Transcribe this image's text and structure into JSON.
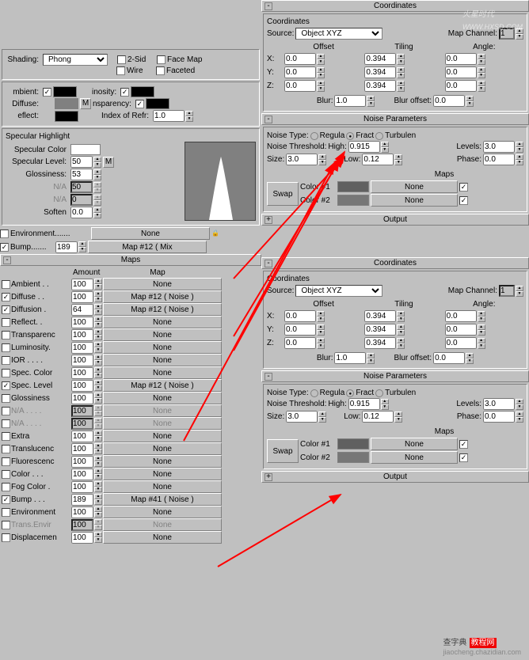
{
  "shading": {
    "label": "Shading:",
    "value": "Phong",
    "opts": {
      "twoSid": "2-Sid",
      "wire": "Wire",
      "faceMap": "Face Map",
      "faceted": "Faceted"
    }
  },
  "basic": {
    "ambient": "mbient:",
    "diffuse": "Diffuse:",
    "reflect": "eflect:",
    "luminosity": "inosity:",
    "transparency": "nsparency:",
    "ior": "Index of Refr:",
    "iorVal": "1.0"
  },
  "spec": {
    "title": "Specular Highlight",
    "color": "Specular Color",
    "level": "Specular Level:",
    "levelVal": "50",
    "gloss": "Glossiness:",
    "glossVal": "53",
    "na": "N/A",
    "naVal": "50",
    "na2": "0",
    "soften": "Soften",
    "softenVal": "0.0"
  },
  "env": {
    "env": "Environment.......",
    "none": "None",
    "bump": "Bump.......",
    "bumpVal": "189",
    "bumpMap": "Map #12  ( Mix"
  },
  "mapsHeader": "Maps",
  "mapsCol": {
    "amount": "Amount",
    "map": "Map"
  },
  "maps": [
    {
      "c": false,
      "n": "Ambient . .",
      "v": "100",
      "m": "None",
      "d": false
    },
    {
      "c": true,
      "n": "Diffuse . .",
      "v": "100",
      "m": "Map #12   ( Noise )",
      "d": false
    },
    {
      "c": true,
      "n": "Diffusion .",
      "v": "64",
      "m": "Map #12   ( Noise )",
      "d": false
    },
    {
      "c": false,
      "n": "Reflect. .",
      "v": "100",
      "m": "None",
      "d": false
    },
    {
      "c": false,
      "n": "Transparenc",
      "v": "100",
      "m": "None",
      "d": false
    },
    {
      "c": false,
      "n": "Luminosity.",
      "v": "100",
      "m": "None",
      "d": false
    },
    {
      "c": false,
      "n": "IOR . . . .",
      "v": "100",
      "m": "None",
      "d": false
    },
    {
      "c": false,
      "n": "Spec. Color",
      "v": "100",
      "m": "None",
      "d": false
    },
    {
      "c": true,
      "n": "Spec. Level",
      "v": "100",
      "m": "Map #12   ( Noise )",
      "d": false
    },
    {
      "c": false,
      "n": "Glossiness",
      "v": "100",
      "m": "None",
      "d": false
    },
    {
      "c": false,
      "n": "N/A . . . .",
      "v": "100",
      "m": "None",
      "d": true
    },
    {
      "c": false,
      "n": "N/A . . . .",
      "v": "100",
      "m": "None",
      "d": true
    },
    {
      "c": false,
      "n": "Extra",
      "v": "100",
      "m": "None",
      "d": false
    },
    {
      "c": false,
      "n": "Translucenc",
      "v": "100",
      "m": "None",
      "d": false
    },
    {
      "c": false,
      "n": "Fluorescenc",
      "v": "100",
      "m": "None",
      "d": false
    },
    {
      "c": false,
      "n": "Color . . .",
      "v": "100",
      "m": "None",
      "d": false
    },
    {
      "c": false,
      "n": "Fog Color .",
      "v": "100",
      "m": "None",
      "d": false
    },
    {
      "c": true,
      "n": "Bump . . .",
      "v": "189",
      "m": "Map #41   ( Noise )",
      "d": false
    },
    {
      "c": false,
      "n": "Environment",
      "v": "100",
      "m": "None",
      "d": false
    },
    {
      "c": false,
      "n": "Trans.Envir",
      "v": "100",
      "m": "None",
      "d": true
    },
    {
      "c": false,
      "n": "Displacemen",
      "v": "100",
      "m": "None",
      "d": false
    }
  ],
  "coords": {
    "header": "Coordinates",
    "sub": "Coordinates",
    "source": "Source:",
    "sourceVal": "Object XYZ",
    "mapCh": "Map Channel:",
    "mapChVal": "1",
    "offset": "Offset",
    "tiling": "Tiling",
    "angle": "Angle:",
    "x": "X:",
    "y": "Y:",
    "z": "Z:",
    "xo": "0.0",
    "xt": "0.394",
    "xa": "0.0",
    "yo": "0.0",
    "yt": "0.394",
    "ya": "0.0",
    "zo": "0.0",
    "zt": "0.394",
    "za": "0.0",
    "blur": "Blur:",
    "blurVal": "1.0",
    "blurOff": "Blur offset:",
    "blurOffVal": "0.0"
  },
  "noise": {
    "header": "Noise Parameters",
    "type": "Noise Type:",
    "reg": "Regula",
    "fract": "Fract",
    "turb": "Turbulen",
    "thresh": "Noise Threshold:",
    "high": "High:",
    "highVal": "0.915",
    "levels": "Levels:",
    "levelsVal": "3.0",
    "size": "Size:",
    "sizeVal": "3.0",
    "low": "Low:",
    "lowVal": "0.12",
    "phase": "Phase:",
    "phaseVal": "0.0",
    "mapsLbl": "Maps",
    "swap": "Swap",
    "c1": "Color #1",
    "c2": "Color #2",
    "none": "None"
  },
  "output": "Output",
  "watermark": "火星时代",
  "wm2": "查字典",
  "wm3": "教程网",
  "wmurl": "jiaocheng.chazidian.com"
}
